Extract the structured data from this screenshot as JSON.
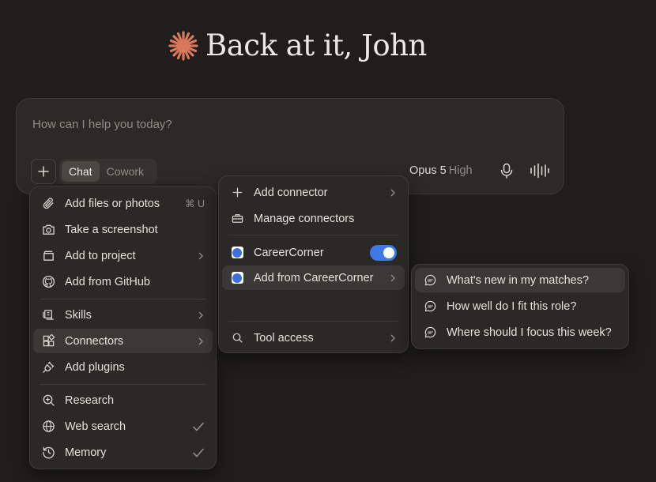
{
  "greeting": {
    "text": "Back at it, John"
  },
  "composer": {
    "placeholder": "How can I help you today?",
    "modes": [
      "Chat",
      "Cowork"
    ],
    "active_mode": "Chat",
    "model_name": "Opus 5",
    "model_level": "High"
  },
  "menu_main": {
    "items": [
      {
        "label": "Add files or photos",
        "icon": "paperclip-icon",
        "shortcut": "⌘ U"
      },
      {
        "label": "Take a screenshot",
        "icon": "camera-icon"
      },
      {
        "label": "Add to project",
        "icon": "project-icon",
        "submenu": true
      },
      {
        "label": "Add from GitHub",
        "icon": "github-icon"
      },
      {
        "label": "Skills",
        "icon": "skills-icon",
        "submenu": true
      },
      {
        "label": "Connectors",
        "icon": "connectors-icon",
        "submenu": true,
        "highlighted": true
      },
      {
        "label": "Add plugins",
        "icon": "plug-icon"
      },
      {
        "label": "Research",
        "icon": "research-icon"
      },
      {
        "label": "Web search",
        "icon": "globe-icon",
        "checked": true
      },
      {
        "label": "Memory",
        "icon": "memory-icon",
        "checked": true
      }
    ]
  },
  "menu_connectors": {
    "items": [
      {
        "label": "Add connector",
        "icon": "plus-icon",
        "submenu": true
      },
      {
        "label": "Manage connectors",
        "icon": "toolbox-icon"
      },
      {
        "label": "CareerCorner",
        "icon": "careercorner-logo-icon",
        "toggle": "on"
      },
      {
        "label": "Add from CareerCorner",
        "icon": "careercorner-logo-icon",
        "submenu": true,
        "highlighted": true
      },
      {
        "label": "Tool access",
        "icon": "search-icon",
        "submenu": true
      }
    ]
  },
  "menu_careercorner": {
    "items": [
      {
        "label": "What's new in my matches?",
        "icon": "chat-bubble-icon",
        "highlighted": true
      },
      {
        "label": "How well do I fit this role?",
        "icon": "chat-bubble-icon"
      },
      {
        "label": "Where should I focus this week?",
        "icon": "chat-bubble-icon"
      }
    ]
  },
  "colors": {
    "background": "#1f1e1c",
    "accent_star": "#d9775b",
    "toggle_on": "#3d7ae8",
    "careercorner_blue": "#3d6fe0"
  }
}
